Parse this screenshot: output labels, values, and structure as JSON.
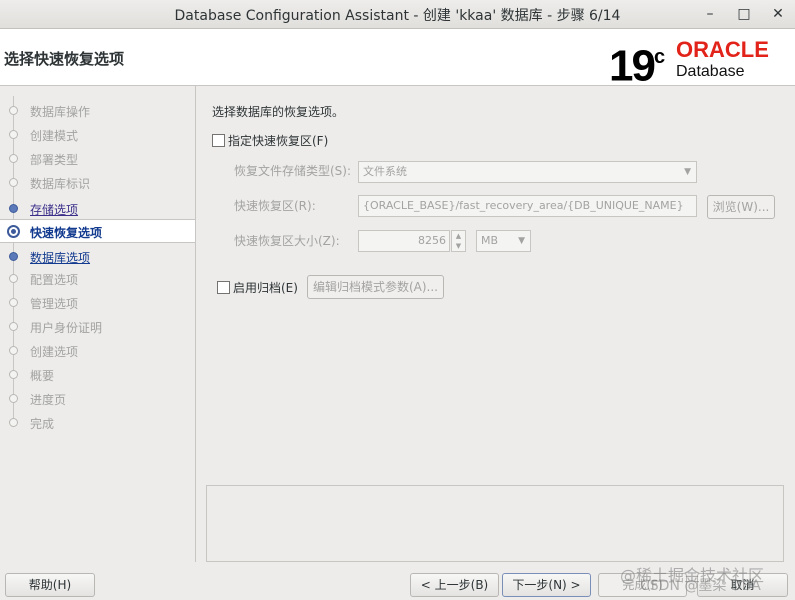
{
  "window": {
    "title": "Database Configuration Assistant - 创建 'kkaa' 数据库 - 步骤 6/14",
    "minimize_glyph": "–",
    "maximize_glyph": "□",
    "close_glyph": "✕"
  },
  "header": {
    "page_title": "选择快速恢复选项",
    "logo_version": "19",
    "logo_superscript": "c",
    "logo_brand": "ORACLE",
    "logo_product": "Database",
    "brand_color": "#e2231a"
  },
  "steps": [
    {
      "label": "数据库操作",
      "state": "pending"
    },
    {
      "label": "创建模式",
      "state": "pending"
    },
    {
      "label": "部署类型",
      "state": "pending"
    },
    {
      "label": "数据库标识",
      "state": "pending"
    },
    {
      "label": "存储选项",
      "state": "done"
    },
    {
      "label": "快速恢复选项",
      "state": "current"
    },
    {
      "label": "数据库选项",
      "state": "active"
    },
    {
      "label": "配置选项",
      "state": "pending"
    },
    {
      "label": "管理选项",
      "state": "pending"
    },
    {
      "label": "用户身份证明",
      "state": "pending"
    },
    {
      "label": "创建选项",
      "state": "pending"
    },
    {
      "label": "概要",
      "state": "pending"
    },
    {
      "label": "进度页",
      "state": "pending"
    },
    {
      "label": "完成",
      "state": "pending"
    }
  ],
  "main": {
    "instruction": "选择数据库的恢复选项。",
    "fra_checkbox_label": "指定快速恢复区(F)",
    "fra_checked": false,
    "storage_type_label": "恢复文件存储类型(S):",
    "storage_type_value": "文件系统",
    "fra_location_label": "快速恢复区(R):",
    "fra_location_value": "{ORACLE_BASE}/fast_recovery_area/{DB_UNIQUE_NAME}",
    "browse_button": "浏览(W)...",
    "fra_size_label": "快速恢复区大小(Z):",
    "fra_size_value": "8256",
    "fra_size_unit": "MB",
    "archive_checkbox_label": "启用归档(E)",
    "archive_checked": false,
    "archive_params_button": "编辑归档模式参数(A)..."
  },
  "footer": {
    "help_button": "帮助(H)",
    "back_button": "< 上一步(B)",
    "next_button": "下一步(N) >",
    "finish_button": "完成(F)",
    "cancel_button": "取消",
    "watermark_1": "@稀土掘金技术社区",
    "watermark_2": "CSDN @墨染 DBA"
  }
}
